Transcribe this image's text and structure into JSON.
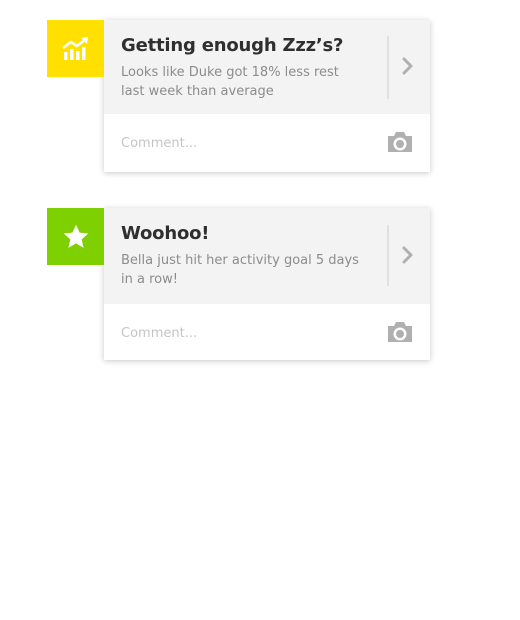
{
  "colors": {
    "badge_sleep": "#ffe000",
    "badge_activity": "#7ed000",
    "header_bg": "#f3f3f3",
    "title_text": "#2f2f2f",
    "body_text": "#8c8c8c",
    "placeholder_text": "#c4c4c4",
    "icon_gray": "#b0b0b0"
  },
  "cards": [
    {
      "badge_icon": "trending-up-bar-chart-icon",
      "title": "Getting enough Zzz’s?",
      "body": "Looks like Duke got 18% less rest last week than average",
      "comment_placeholder": "Comment..."
    },
    {
      "badge_icon": "star-icon",
      "title": "Woohoo!",
      "body": "Bella just hit her activity goal 5 days in a row!",
      "comment_placeholder": "Comment..."
    }
  ]
}
